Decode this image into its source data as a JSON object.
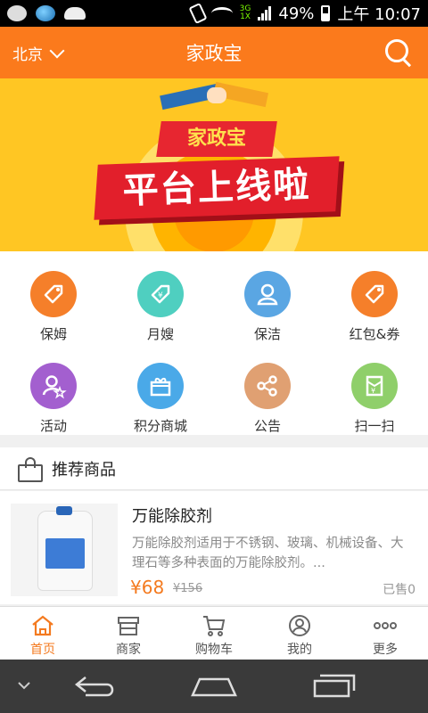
{
  "status_bar": {
    "network_label": "3G\n1X",
    "battery_percent": "49%",
    "time": "上午 10:07"
  },
  "header": {
    "city": "北京",
    "title": "家政宝"
  },
  "banner": {
    "ribbon_text": "家政宝",
    "main_text": "平台上线啦"
  },
  "categories": [
    {
      "label": "保姆",
      "color": "#f57f2a",
      "icon": "tag-icon"
    },
    {
      "label": "月嫂",
      "color": "#4fcfc0",
      "icon": "yen-tag-icon"
    },
    {
      "label": "保洁",
      "color": "#5aa6e3",
      "icon": "person-icon"
    },
    {
      "label": "红包&券",
      "color": "#f57f2a",
      "icon": "tag-icon"
    },
    {
      "label": "活动",
      "color": "#a35fcf",
      "icon": "person-star-icon"
    },
    {
      "label": "积分商城",
      "color": "#4aa9e8",
      "icon": "gift-icon"
    },
    {
      "label": "公告",
      "color": "#e0a072",
      "icon": "share-icon"
    },
    {
      "label": "扫一扫",
      "color": "#8fcf6a",
      "icon": "yen-envelope-icon"
    }
  ],
  "section": {
    "title": "推荐商品"
  },
  "product": {
    "name": "万能除胶剂",
    "description": "万能除胶剂适用于不锈钢、玻璃、机械设备、大理石等多种表面的万能除胶剂。...",
    "price": "¥68",
    "old_price": "¥156",
    "sold": "已售0"
  },
  "tabs": [
    {
      "label": "首页",
      "icon": "home-icon",
      "active": true
    },
    {
      "label": "商家",
      "icon": "shop-icon",
      "active": false
    },
    {
      "label": "购物车",
      "icon": "cart-icon",
      "active": false
    },
    {
      "label": "我的",
      "icon": "user-icon",
      "active": false
    },
    {
      "label": "更多",
      "icon": "more-icon",
      "active": false
    }
  ],
  "colors": {
    "accent": "#fb7a1c",
    "banner_bg": "#ffc623",
    "price": "#f47a1f"
  }
}
